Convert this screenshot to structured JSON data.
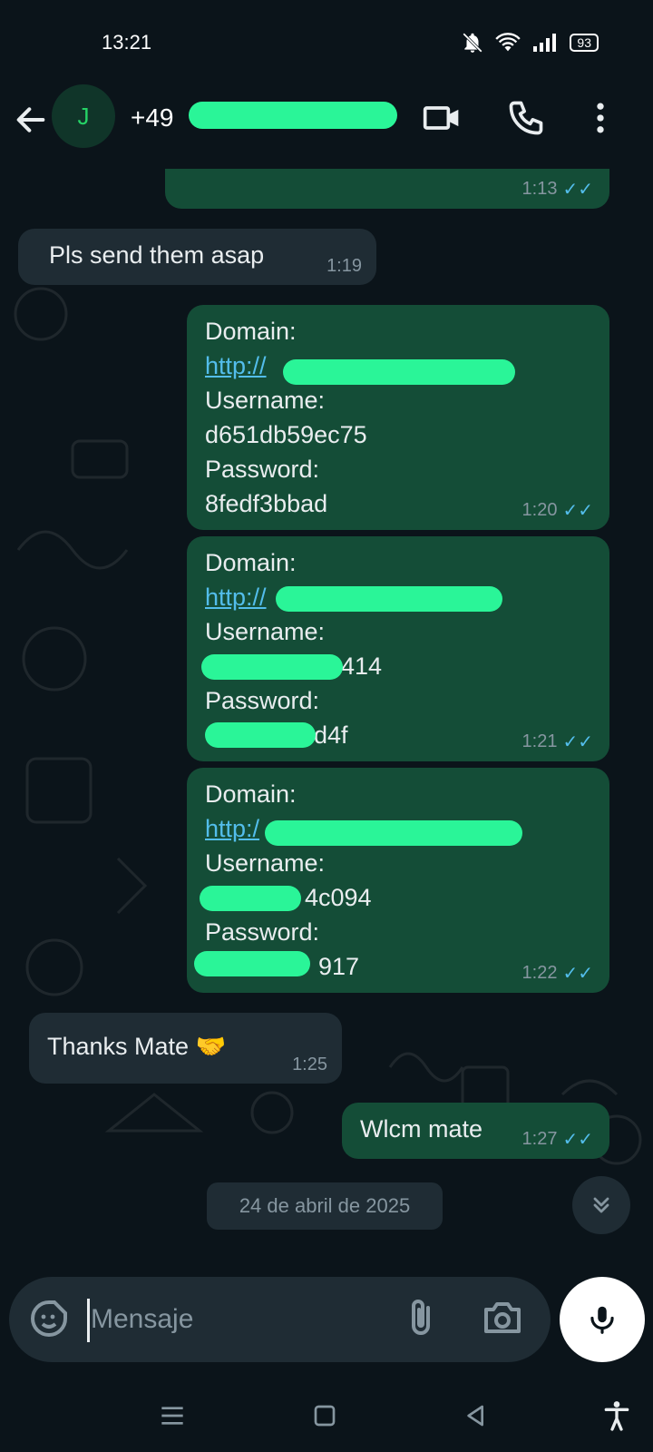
{
  "status_bar": {
    "time": "13:21",
    "battery": "93"
  },
  "header": {
    "avatar_initial": "J",
    "contact_visible": "+49"
  },
  "messages": [
    {
      "type": "out",
      "time": "1:13"
    },
    {
      "type": "in",
      "text": "Pls send them asap",
      "time": "1:19"
    },
    {
      "type": "out",
      "domain_label": "Domain:",
      "domain_prefix": "http://",
      "username_label": "Username:",
      "username": "d651db59ec75",
      "password_label": "Password:",
      "password": "8fedf3bbad",
      "time": "1:20"
    },
    {
      "type": "out",
      "domain_label": "Domain:",
      "domain_prefix": "http://",
      "username_label": "Username:",
      "username_tail": "414",
      "password_label": "Password:",
      "password_tail": "d4f",
      "time": "1:21"
    },
    {
      "type": "out",
      "domain_label": "Domain:",
      "domain_prefix": "http:/",
      "username_label": "Username:",
      "username_tail": "4c094",
      "password_label": "Password:",
      "password_tail": "917",
      "time": "1:22"
    },
    {
      "type": "in",
      "text": "Thanks Mate 🤝",
      "time": "1:25"
    },
    {
      "type": "out",
      "text": "Wlcm mate",
      "time": "1:27"
    }
  ],
  "date_chip": "24 de abril de 2025",
  "composer": {
    "placeholder": "Mensaje"
  },
  "colors": {
    "outgoing": "#144d37",
    "incoming": "#1f2c34",
    "accent": "#25d366",
    "ticks": "#53bdeb",
    "redaction": "#2af598"
  },
  "icons": [
    "back-arrow-icon",
    "video-call-icon",
    "phone-icon",
    "more-options-icon",
    "sticker-icon",
    "attach-icon",
    "camera-icon",
    "mic-icon",
    "double-chevron-down-icon",
    "menu-nav-icon",
    "home-nav-icon",
    "back-nav-icon",
    "accessibility-icon"
  ]
}
